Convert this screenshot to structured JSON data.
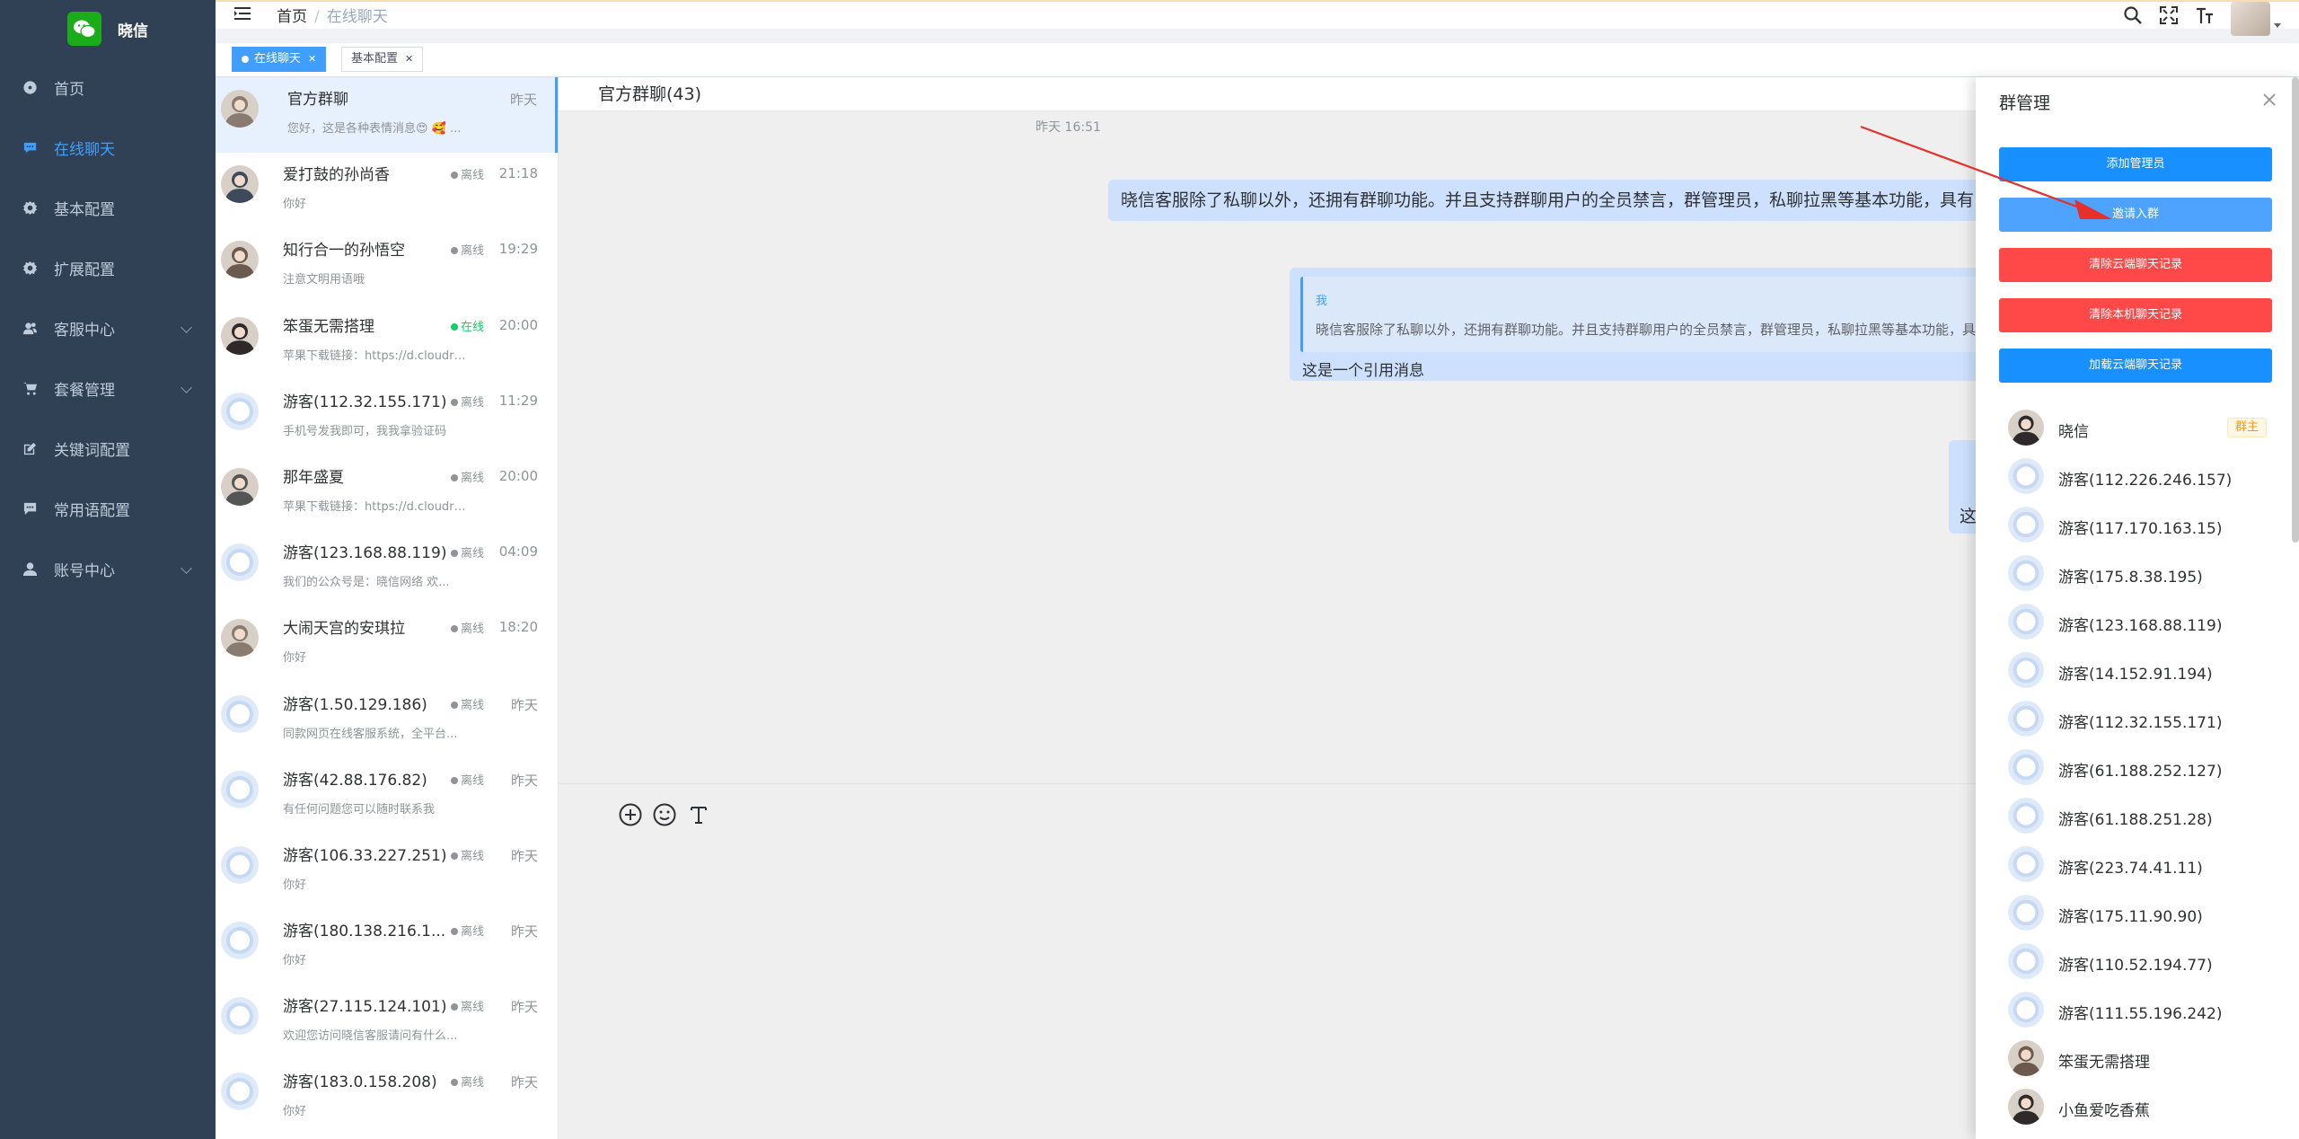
{
  "app": {
    "logo_text": "晓信",
    "brand_color": "#1aad19",
    "accent": "#409eff"
  },
  "sidebar": {
    "items": [
      {
        "label": "首页",
        "icon": "dashboard-icon"
      },
      {
        "label": "在线聊天",
        "icon": "chat-icon",
        "active": true
      },
      {
        "label": "基本配置",
        "icon": "gear-icon"
      },
      {
        "label": "扩展配置",
        "icon": "gear-icon"
      },
      {
        "label": "客服中心",
        "icon": "user-group-icon",
        "has_arrow": true
      },
      {
        "label": "套餐管理",
        "icon": "cart-icon",
        "has_arrow": true
      },
      {
        "label": "关键词配置",
        "icon": "edit-icon"
      },
      {
        "label": "常用语配置",
        "icon": "message-icon"
      },
      {
        "label": "账号中心",
        "icon": "user-icon",
        "has_arrow": true
      }
    ]
  },
  "header": {
    "breadcrumb_home": "首页",
    "breadcrumb_sep": "/",
    "breadcrumb_current": "在线聊天"
  },
  "tabs": [
    {
      "label": "在线聊天",
      "active": true
    },
    {
      "label": "基本配置",
      "active": false
    }
  ],
  "conversations": [
    {
      "name": "官方群聊",
      "status": "",
      "time": "昨天",
      "msg": "您好，这是各种表情消息😍 🥰 ...",
      "active": true,
      "avatar": "photo"
    },
    {
      "name": "爱打鼓的孙尚香",
      "status": "离线",
      "time": "21:18",
      "msg": "你好",
      "avatar": "photo"
    },
    {
      "name": "知行合一的孙悟空",
      "status": "离线",
      "time": "19:29",
      "msg": "注意文明用语哦",
      "avatar": "photo"
    },
    {
      "name": "笨蛋无需搭理",
      "status": "在线",
      "online": true,
      "time": "20:00",
      "msg": "苹果下载链接：https://d.cloudr2...",
      "avatar": "photo"
    },
    {
      "name": "游客(112.32.155.171)",
      "status": "离线",
      "time": "11:29",
      "msg": "手机号发我即可，我我拿验证码",
      "avatar": "default"
    },
    {
      "name": "那年盛夏",
      "status": "离线",
      "time": "20:00",
      "msg": "苹果下载链接：https://d.cloudr2...",
      "avatar": "photo"
    },
    {
      "name": "游客(123.168.88.119)",
      "status": "离线",
      "time": "04:09",
      "msg": "我们的公众号是：晓信网络 欢...",
      "avatar": "default"
    },
    {
      "name": "大闹天宫的安琪拉",
      "status": "离线",
      "time": "18:20",
      "msg": "你好",
      "avatar": "photo"
    },
    {
      "name": "游客(1.50.129.186)",
      "status": "离线",
      "time": "昨天",
      "msg": "同款网页在线客服系统，全平台...",
      "avatar": "default"
    },
    {
      "name": "游客(42.88.176.82)",
      "status": "离线",
      "time": "昨天",
      "msg": "有任何问题您可以随时联系我",
      "avatar": "default"
    },
    {
      "name": "游客(106.33.227.251)",
      "status": "离线",
      "time": "昨天",
      "msg": "你好",
      "avatar": "default"
    },
    {
      "name": "游客(180.138.216.1...",
      "status": "离线",
      "time": "昨天",
      "msg": "你好",
      "avatar": "default"
    },
    {
      "name": "游客(27.115.124.101)",
      "status": "离线",
      "time": "昨天",
      "msg": "欢迎您访问晓信客服请问有什么...",
      "avatar": "default"
    },
    {
      "name": "游客(183.0.158.208)",
      "status": "离线",
      "time": "昨天",
      "msg": "你好",
      "avatar": "default"
    }
  ],
  "chat": {
    "title": "官方群聊(43)",
    "timestamp": "昨天 16:51",
    "message1": "晓信客服除了私聊以外，还拥有群聊功能。并且支持群聊用户的全员禁言，群管理员，私聊拉黑等基本功能，具有",
    "quote_author": "我",
    "quote_text": "晓信客服除了私聊以外，还拥有群聊功能。并且支持群聊用户的全员禁言，群管理员，私聊拉黑等基本功能，具",
    "quote_reply": "这是一个引用消息",
    "message3_partial": "这"
  },
  "panel": {
    "title": "群管理",
    "buttons": [
      {
        "label": "添加管理员",
        "color": "#1890ff"
      },
      {
        "label": "邀请入群",
        "color": "#4da3ff"
      },
      {
        "label": "清除云端聊天记录",
        "color": "#ff4949"
      },
      {
        "label": "清除本机聊天记录",
        "color": "#ff4949"
      },
      {
        "label": "加载云端聊天记录",
        "color": "#1890ff"
      }
    ],
    "members": [
      {
        "name": "晓信",
        "badge": "群主",
        "avatar": "photo"
      },
      {
        "name": "游客(112.226.246.157)",
        "avatar": "default"
      },
      {
        "name": "游客(117.170.163.15)",
        "avatar": "default"
      },
      {
        "name": "游客(175.8.38.195)",
        "avatar": "default"
      },
      {
        "name": "游客(123.168.88.119)",
        "avatar": "default"
      },
      {
        "name": "游客(14.152.91.194)",
        "avatar": "default"
      },
      {
        "name": "游客(112.32.155.171)",
        "avatar": "default"
      },
      {
        "name": "游客(61.188.252.127)",
        "avatar": "default"
      },
      {
        "name": "游客(61.188.251.28)",
        "avatar": "default"
      },
      {
        "name": "游客(223.74.41.11)",
        "avatar": "default"
      },
      {
        "name": "游客(175.11.90.90)",
        "avatar": "default"
      },
      {
        "name": "游客(110.52.194.77)",
        "avatar": "default"
      },
      {
        "name": "游客(111.55.196.242)",
        "avatar": "default"
      },
      {
        "name": "笨蛋无需搭理",
        "avatar": "photo"
      },
      {
        "name": "小鱼爱吃香蕉",
        "avatar": "photo"
      }
    ]
  }
}
